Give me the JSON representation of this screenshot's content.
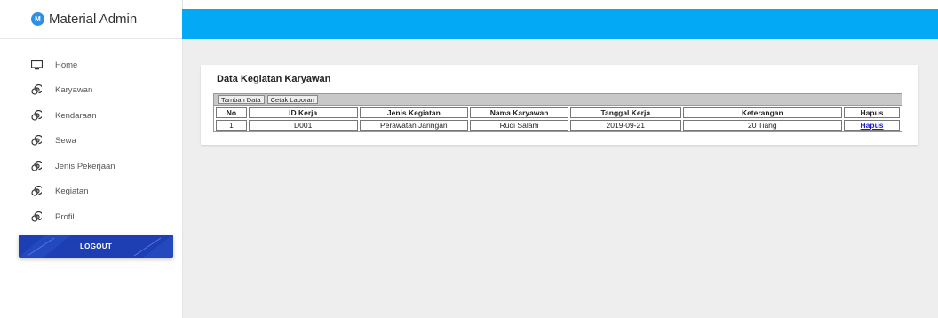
{
  "brand": {
    "logo_letter": "M",
    "name": "Material Admin"
  },
  "menu": [
    {
      "label": "Home",
      "icon": "monitor-icon"
    },
    {
      "label": "Karyawan",
      "icon": "spiral-icon"
    },
    {
      "label": "Kendaraan",
      "icon": "spiral-icon"
    },
    {
      "label": "Sewa",
      "icon": "spiral-icon"
    },
    {
      "label": "Jenis Pekerjaan",
      "icon": "spiral-icon"
    },
    {
      "label": "Kegiatan",
      "icon": "spiral-icon"
    },
    {
      "label": "Profil",
      "icon": "spiral-icon"
    }
  ],
  "logout_label": "LOGOUT",
  "colors": {
    "topbar": "#03a9f4",
    "logout": "#1d3fb3",
    "link": "#1a1ad6"
  },
  "card": {
    "title": "Data Kegiatan Karyawan",
    "toolbar": {
      "add_label": "Tambah Data",
      "print_label": "Cetak Laporan"
    },
    "columns": [
      "No",
      "ID Kerja",
      "Jenis Kegiatan",
      "Nama Karyawan",
      "Tanggal Kerja",
      "Keterangan",
      "Hapus"
    ],
    "rows": [
      {
        "no": "1",
        "id": "D001",
        "jenis": "Perawatan Jaringan",
        "nama": "Rudi Salam",
        "tanggal": "2019-09-21",
        "keterangan": "20 Tiang",
        "hapus": "Hapus"
      }
    ]
  }
}
